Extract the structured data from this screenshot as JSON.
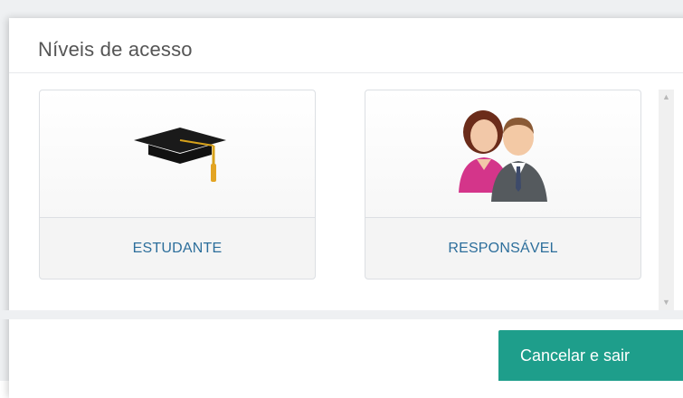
{
  "modal": {
    "title": "Níveis de acesso"
  },
  "roles": [
    {
      "label": "ESTUDANTE",
      "icon": "graduation-cap-icon"
    },
    {
      "label": "RESPONSÁVEL",
      "icon": "parents-icon"
    }
  ],
  "footer": {
    "cancel_label": "Cancelar e sair"
  },
  "colors": {
    "accent": "#1e9e8b",
    "card_label": "#2c6e9b",
    "title": "#555555"
  }
}
